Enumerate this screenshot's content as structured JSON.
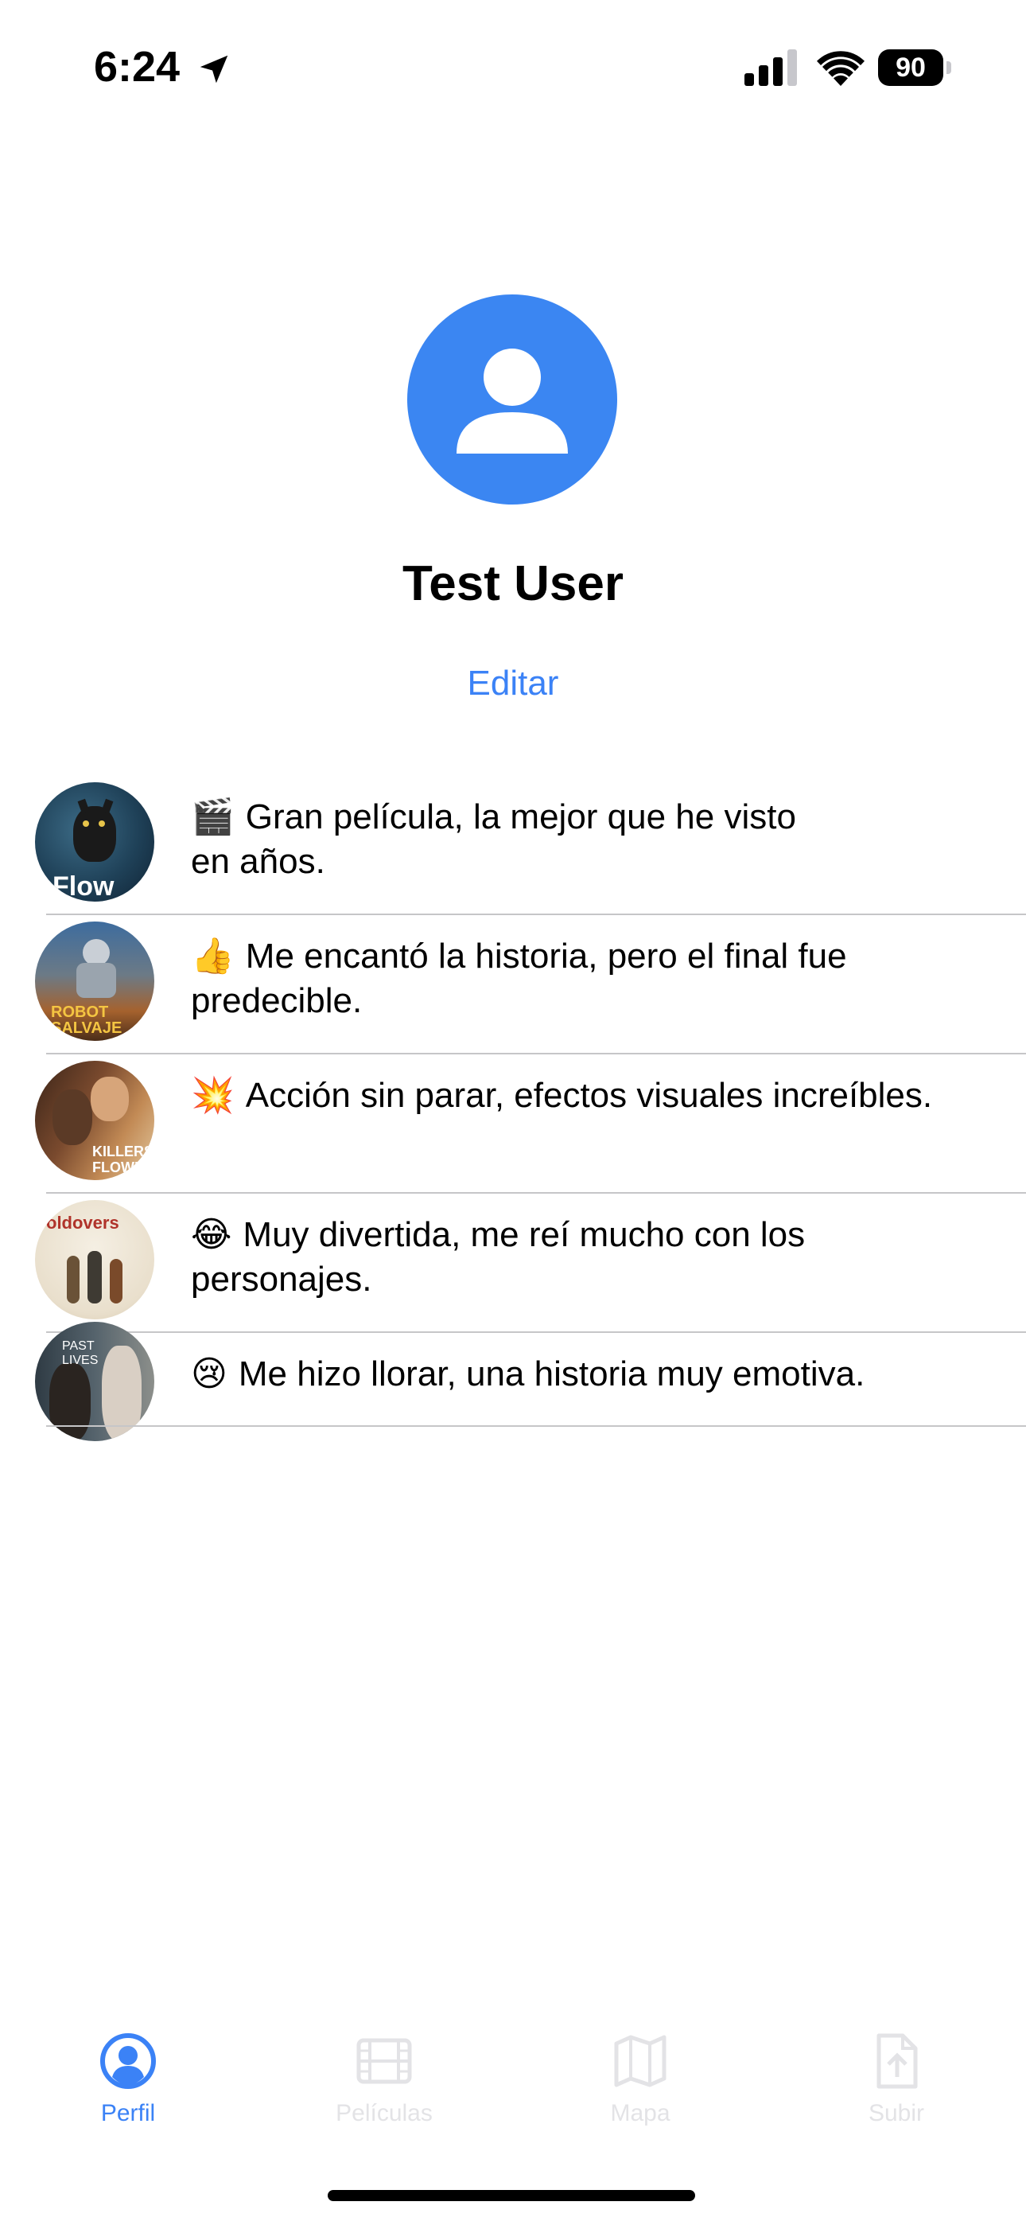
{
  "status_bar": {
    "time": "6:24",
    "battery": "90"
  },
  "profile": {
    "name": "Test User",
    "edit_label": "Editar"
  },
  "reviews": [
    {
      "emoji": "🎬",
      "text": "Gran película, la mejor que he visto\nen años.",
      "poster_title": "Flow"
    },
    {
      "emoji": "👍",
      "text": "Me encantó la historia, pero el final fue predecible.",
      "poster_title": "ROBOT SALVAJE"
    },
    {
      "emoji": "💥",
      "text": "Acción sin parar, efectos visuales increíbles.",
      "poster_title": "KILLERS FLOWER"
    },
    {
      "emoji": "😂",
      "text": "Muy divertida, me reí mucho con los personajes.",
      "poster_title": "oldovers"
    },
    {
      "emoji": "😢",
      "text": "Me hizo llorar, una historia muy emotiva.",
      "poster_title": "PAST LIVES"
    }
  ],
  "tabs": [
    {
      "label": "Perfil",
      "icon": "person-circle-icon",
      "active": true
    },
    {
      "label": "Películas",
      "icon": "film-icon",
      "active": false
    },
    {
      "label": "Mapa",
      "icon": "map-icon",
      "active": false
    },
    {
      "label": "Subir",
      "icon": "upload-document-icon",
      "active": false
    }
  ],
  "colors": {
    "accent": "#3b82f6",
    "avatar_bg": "#3b86f2",
    "inactive_tab": "#e3e3e6",
    "divider": "#c6c6c8"
  }
}
